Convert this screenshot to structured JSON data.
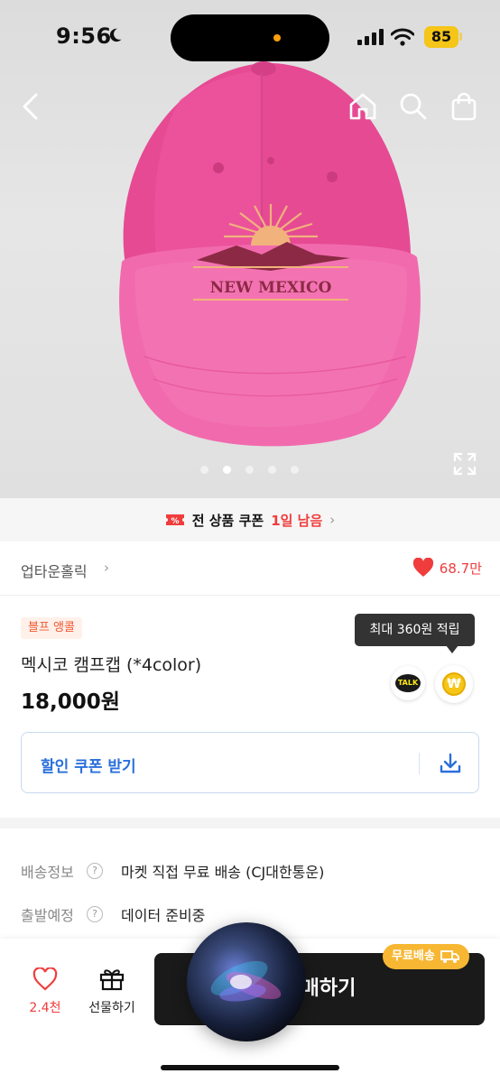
{
  "status_bar": {
    "time": "9:56",
    "battery": "85"
  },
  "hero": {
    "image_text": "NEW MEXICO",
    "page_count": 5,
    "active_page": 1
  },
  "coupon_strip": {
    "text_main": "전 상품 쿠폰",
    "text_highlight": "1일 남음"
  },
  "store": {
    "name": "업타운홀릭",
    "likes": "68.7만"
  },
  "product": {
    "badge": "블프 앵콜",
    "title": "멕시코 캠프캡 (*4color)",
    "price": "18,000원",
    "points_tooltip": "최대 360원 적립",
    "talk_label": "TALK",
    "coin_label": "₩"
  },
  "coupon_button": {
    "label": "할인 쿠폰 받기"
  },
  "shipping": [
    {
      "key": "배송정보",
      "value": "마켓 직접 무료 배송 (CJ대한통운)"
    },
    {
      "key": "출발예정",
      "value": "데이터 준비중"
    }
  ],
  "bottom_bar": {
    "like_count": "2.4천",
    "gift_label": "선물하기",
    "buy_label_visible": "매하기",
    "free_shipping_badge": "무료배송"
  },
  "colors": {
    "accent_red": "#f03c3c",
    "accent_blue": "#2a6fdb",
    "buy_bg": "#1a1a1a",
    "badge_orange": "#f7b733"
  }
}
